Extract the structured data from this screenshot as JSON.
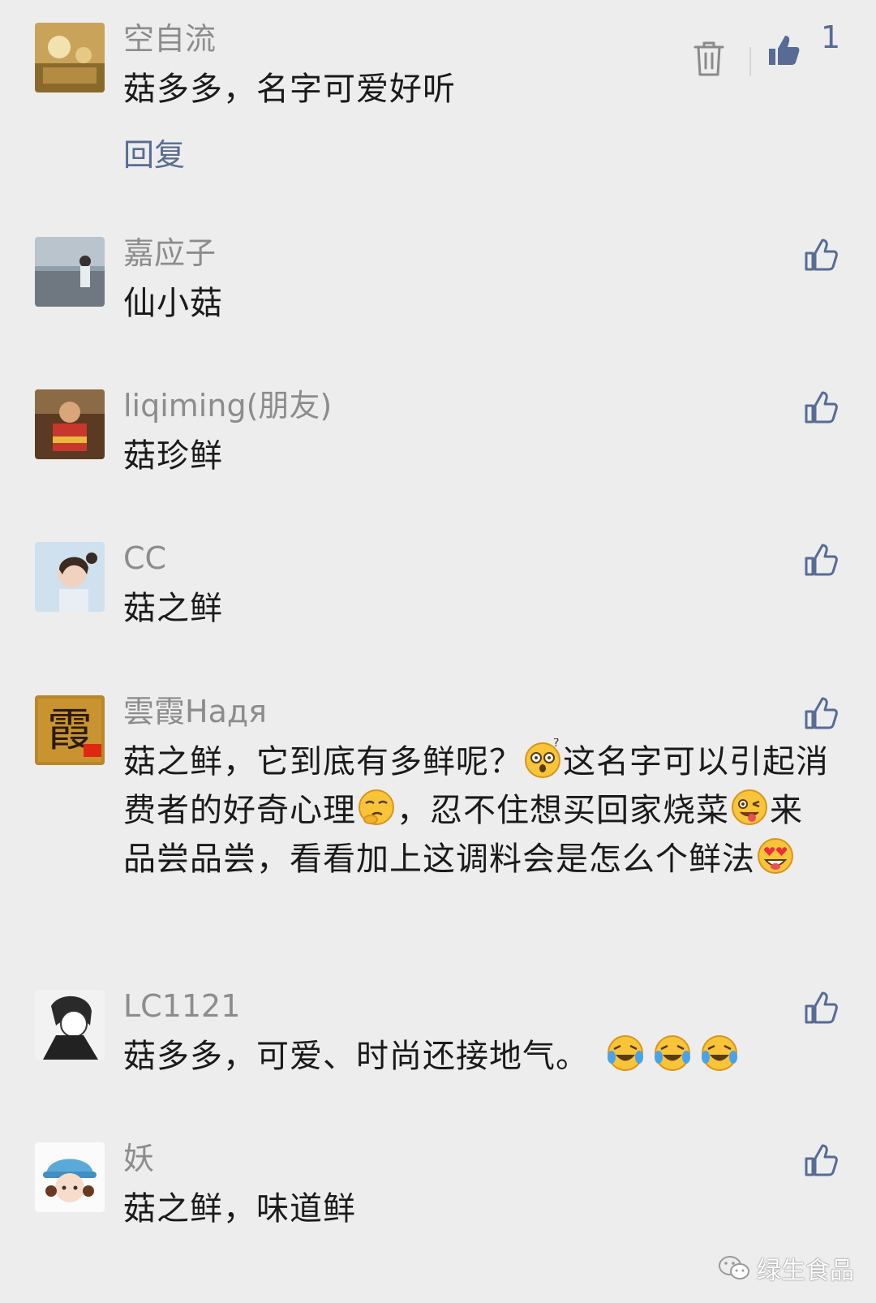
{
  "comments": [
    {
      "name": "空自流",
      "text": "菇多多，名字可爱好听",
      "likes": "1",
      "reply_label": "回复"
    },
    {
      "name": "嘉应子",
      "text": "仙小菇"
    },
    {
      "name": "liqiming(朋友)",
      "text": "菇珍鲜"
    },
    {
      "name": "CC",
      "text": "菇之鲜"
    },
    {
      "name": "雲霞Надя",
      "segments": [
        "菇之鲜，它到底有多鲜呢？",
        "这名字可以引起消费者的好奇心理",
        "，忍不住想买回家烧菜",
        "来品尝品尝，看看加上这调料会是怎么个鲜法"
      ],
      "emojis": [
        "dizzy-face-emoji",
        "thinking-face-emoji",
        "winking-tongue-emoji",
        "heart-eyes-emoji"
      ]
    },
    {
      "name": "LC1121",
      "text": "菇多多，可爱、时尚还接地气。",
      "emojis": [
        "laughing-tears-emoji",
        "laughing-tears-emoji",
        "laughing-tears-emoji"
      ]
    },
    {
      "name": "妖",
      "text": "菇之鲜，味道鲜"
    }
  ],
  "watermark": "绿生食品",
  "colors": {
    "link": "#576b95",
    "background": "#ededed",
    "name": "#8c8c8c"
  }
}
